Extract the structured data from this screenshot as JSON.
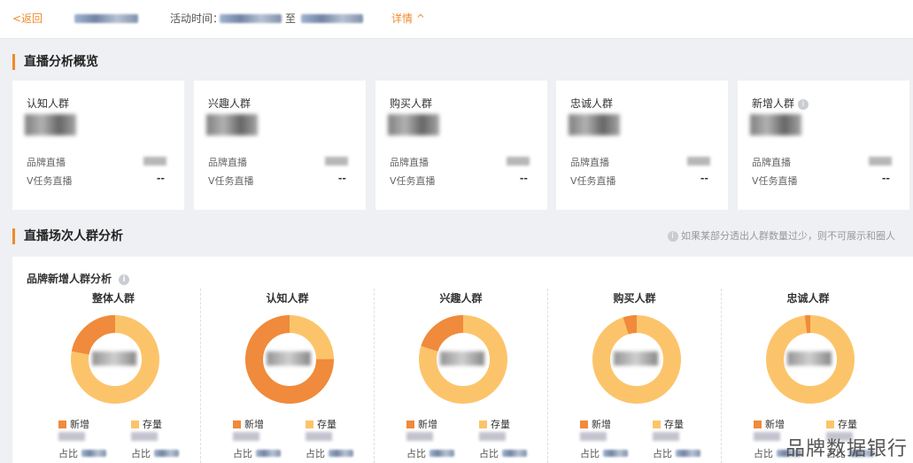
{
  "topbar": {
    "back_label": "<返回",
    "time_label": "活动时间：",
    "time_sep": "至",
    "detail_label": "详情 ^"
  },
  "overview": {
    "title": "直播分析概览",
    "cards": [
      {
        "title": "认知人群",
        "row1": "品牌直播",
        "row2": "V任务直播",
        "row2_value": "--",
        "info": false
      },
      {
        "title": "兴趣人群",
        "row1": "品牌直播",
        "row2": "V任务直播",
        "row2_value": "--",
        "info": false
      },
      {
        "title": "购买人群",
        "row1": "品牌直播",
        "row2": "V任务直播",
        "row2_value": "--",
        "info": false
      },
      {
        "title": "忠诚人群",
        "row1": "品牌直播",
        "row2": "V任务直播",
        "row2_value": "--",
        "info": false
      },
      {
        "title": "新增人群",
        "row1": "品牌直播",
        "row2": "V任务直播",
        "row2_value": "--",
        "info": true
      }
    ]
  },
  "session": {
    "title": "直播场次人群分析",
    "hint": "如果某部分透出人群数量过少，则不可展示和圈人",
    "panel_title": "品牌新增人群分析",
    "legend_new": "新增",
    "legend_stock": "存量",
    "ratio_label": "占比",
    "colors": {
      "new": "#f08a3c",
      "stock": "#fcc46a"
    },
    "columns": [
      {
        "title": "整体人群",
        "new_share": 0.22
      },
      {
        "title": "认知人群",
        "new_share": 0.75
      },
      {
        "title": "兴趣人群",
        "new_share": 0.2
      },
      {
        "title": "购买人群",
        "new_share": 0.05
      },
      {
        "title": "忠诚人群",
        "new_share": 0.02
      }
    ]
  },
  "watermark": "品牌数据银行"
}
